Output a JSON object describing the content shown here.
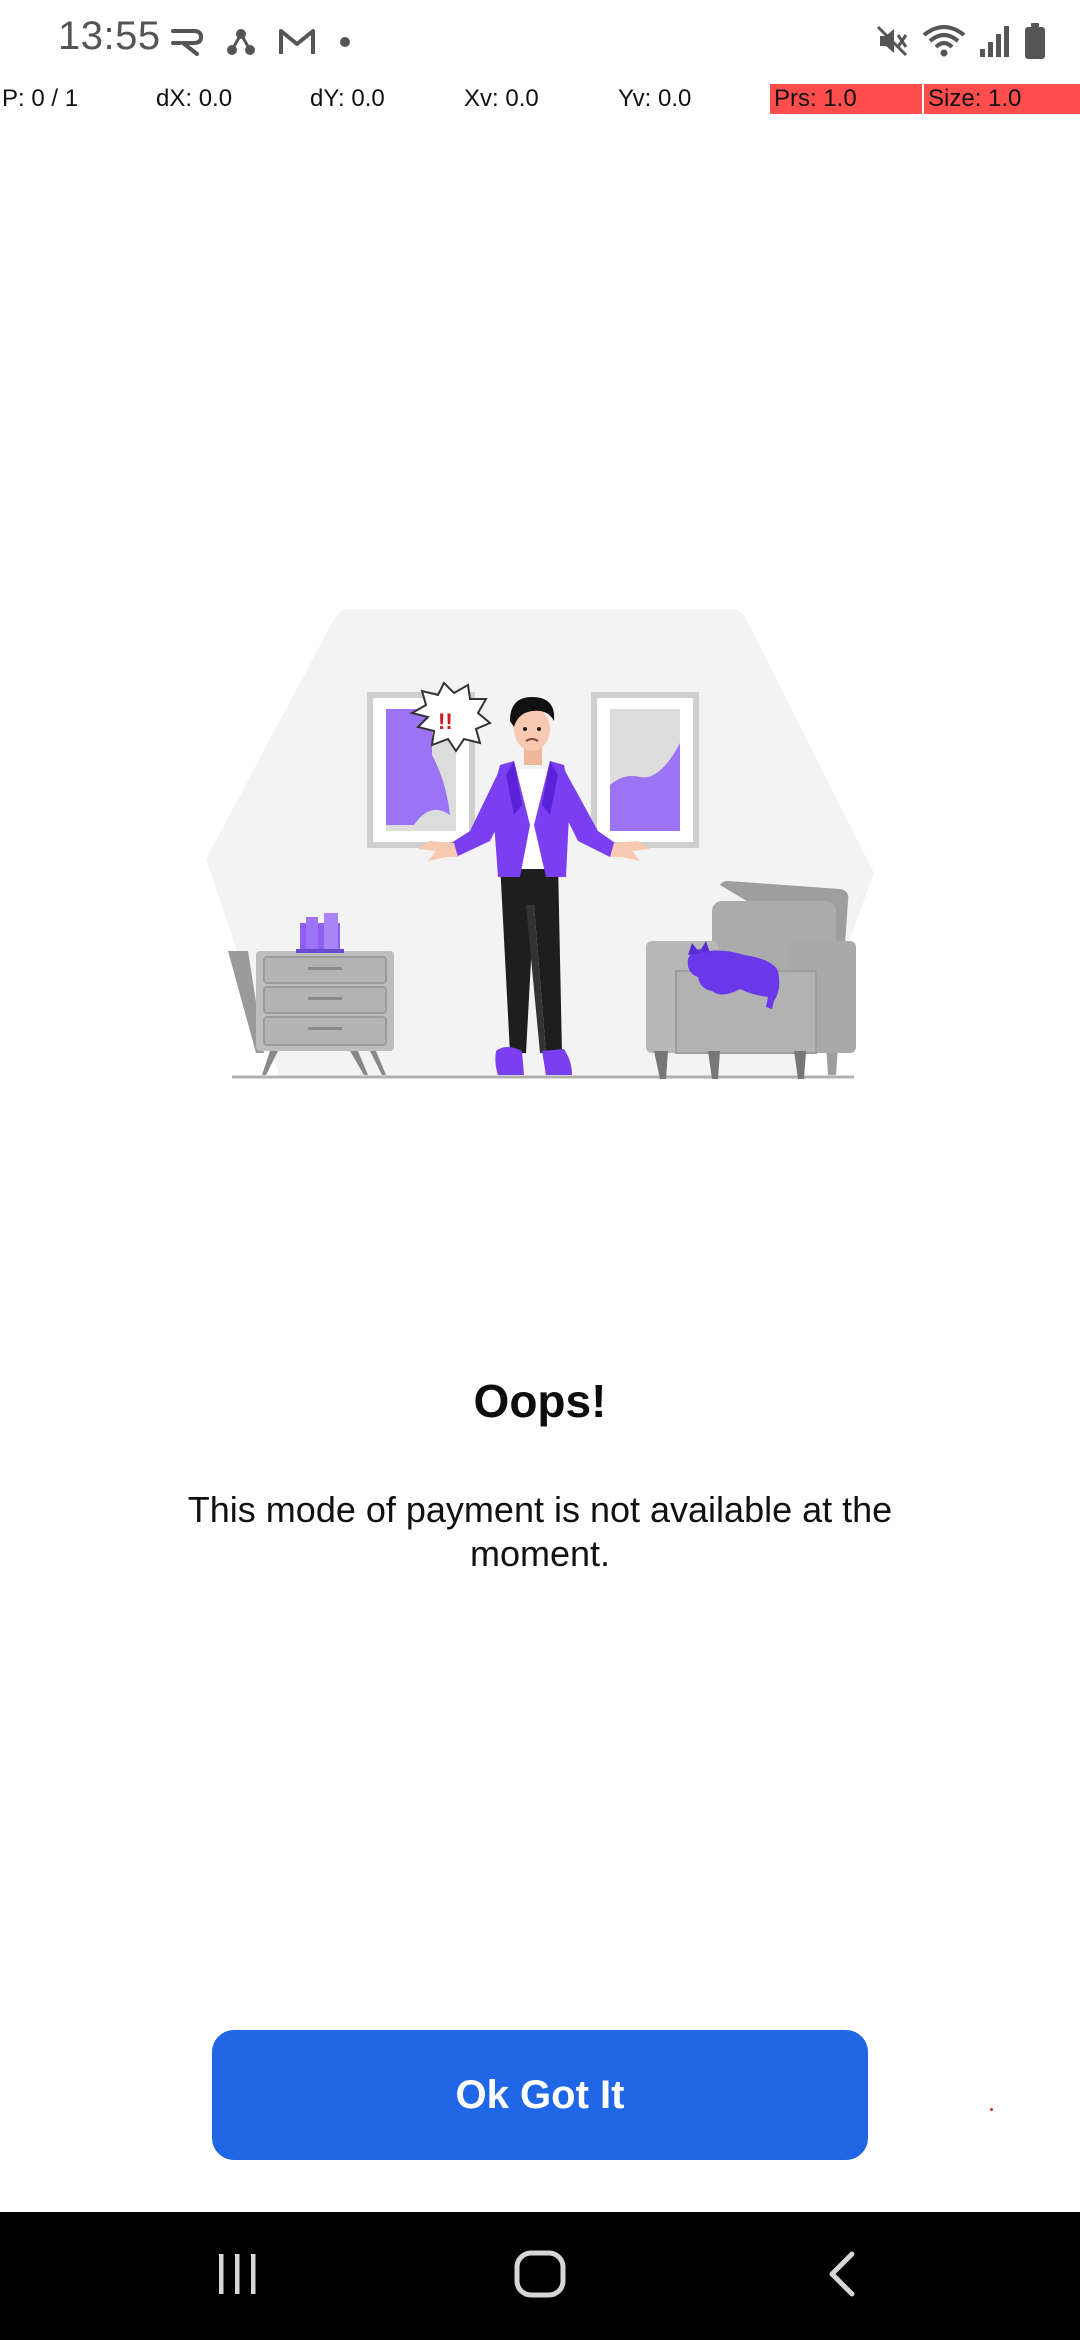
{
  "status_bar": {
    "time": "13:55",
    "left_icons": [
      "r-app-icon",
      "share-network-icon",
      "gmail-icon",
      "dot-icon"
    ],
    "right_icons": [
      "mute-icon",
      "wifi-icon",
      "signal-icon",
      "battery-icon"
    ]
  },
  "pointer_location": {
    "pointers": "P: 0 / 1",
    "dx": "dX: 0.0",
    "dy": "dY: 0.0",
    "xv": "Xv: 0.0",
    "yv": "Yv: 0.0",
    "prs": "Prs: 1.0",
    "size": "Size: 1.0",
    "highlight_color": "#ff4d4d"
  },
  "dialog": {
    "illustration": "confused-person-in-room-illustration",
    "title": "Oops!",
    "message": "This mode of payment is not available at the moment.",
    "button_label": "Ok Got It",
    "accent_color": "#1f67e6",
    "illustration_accent": "#7b3ff2"
  },
  "nav_bar": {
    "buttons": [
      "recents-icon",
      "home-icon",
      "back-icon"
    ]
  }
}
